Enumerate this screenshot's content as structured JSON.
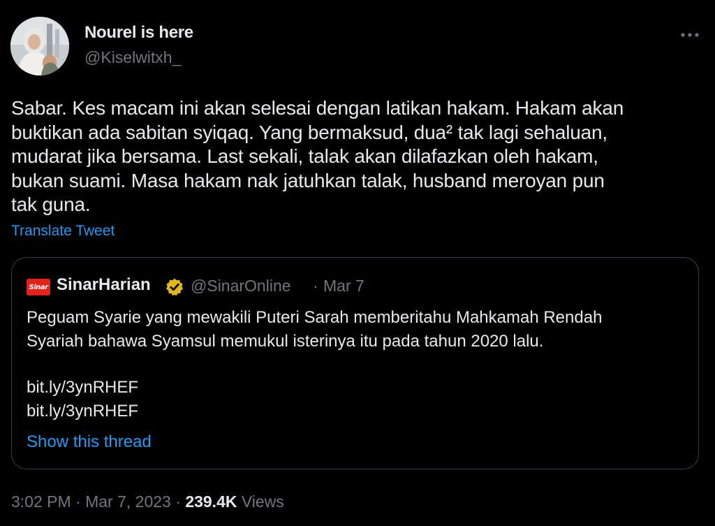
{
  "author": {
    "display_name": "Nourel is here",
    "handle": "@Kiselwitxh_"
  },
  "more_icon": "more-horizontal-icon",
  "tweet": {
    "text": "Sabar. Kes macam ini akan selesai dengan latikan hakam. Hakam akan\nbuktikan ada sabitan syiqaq. Yang bermaksud, dua² tak lagi sehaluan,\nmudarat jika bersama. Last sekali, talak akan dilafazkan oleh hakam,\nbukan suami. Masa hakam nak jatuhkan talak, husband meroyan pun\ntak guna.",
    "translate_label": "Translate Tweet"
  },
  "quote": {
    "logo_text": "Sinar",
    "name": "SinarHarian",
    "verified_icon": "verified-badge-icon",
    "handle": "@SinarOnline",
    "separator": "·",
    "date": "Mar 7",
    "text": "Peguam Syarie yang mewakili Puteri Sarah memberitahu Mahkamah Rendah\nSyariah bahawa Syamsul memukul isterinya itu pada tahun 2020 lalu.",
    "links": [
      "bit.ly/3ynRHEF",
      "bit.ly/3ynRHEF"
    ],
    "show_thread_label": "Show this thread"
  },
  "meta": {
    "time": "3:02 PM",
    "sep1": "·",
    "date": "Mar 7, 2023",
    "sep2": "·",
    "views_count": "239.4K",
    "views_label": "Views"
  },
  "colors": {
    "background": "#000000",
    "text_primary": "#e7e9ea",
    "text_secondary": "#71767b",
    "link": "#1d9bf0",
    "border": "#3a3e43",
    "verified_gold": "#e2b719",
    "brand_red": "#e2231a"
  }
}
